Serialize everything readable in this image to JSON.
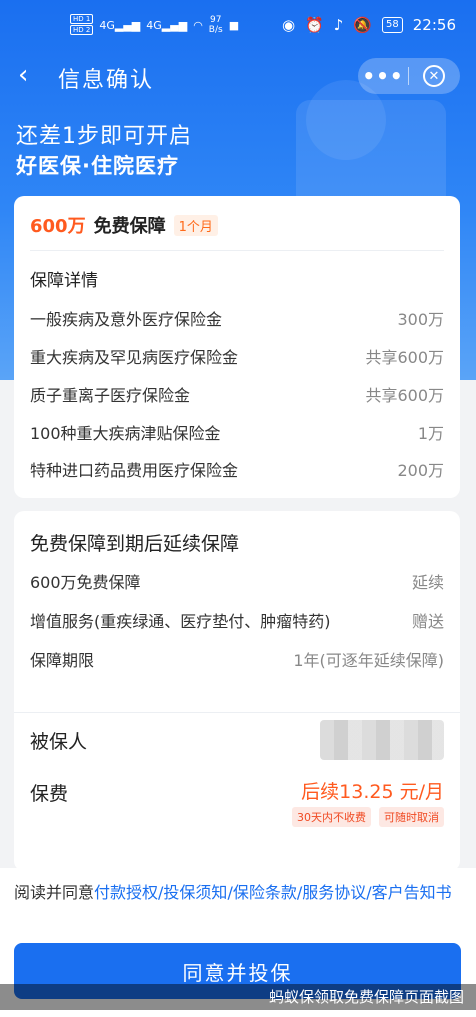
{
  "status_bar": {
    "hd1": "HD 1",
    "hd2": "HD 2",
    "net1": "4G",
    "net2": "4G",
    "speed_value": "97",
    "speed_unit": "B/s",
    "battery": "58",
    "time": "22:56"
  },
  "nav": {
    "back": "‹",
    "title": "信息确认",
    "more": "•••",
    "close": "✕"
  },
  "hero": {
    "line1": "还差1步即可开启",
    "line2": "好医保·住院医疗"
  },
  "coverage_card": {
    "amount": "600万",
    "free_label": "免费保障",
    "period_badge": "1个月",
    "section_title": "保障详情",
    "rows": [
      {
        "label": "一般疾病及意外医疗保险金",
        "value": "300万"
      },
      {
        "label": "重大疾病及罕见病医疗保险金",
        "value": "共享600万"
      },
      {
        "label": "质子重离子医疗保险金",
        "value": "共享600万"
      },
      {
        "label": "100种重大疾病津贴保险金",
        "value": "1万"
      },
      {
        "label": "特种进口药品费用医疗保险金",
        "value": "200万"
      }
    ]
  },
  "renewal_card": {
    "title": "免费保障到期后延续保障",
    "rows": [
      {
        "label": "600万免费保障",
        "value": "延续"
      },
      {
        "label": "增值服务(重疾绿通、医疗垫付、肿瘤特药)",
        "value": "赠送"
      },
      {
        "label": "保障期限",
        "value": "1年(可逐年延续保障)"
      }
    ],
    "insured_label": "被保人",
    "fee_label": "保费",
    "fee_value": "后续13.25 元/月",
    "tags": [
      "30天内不收费",
      "可随时取消"
    ]
  },
  "agreement": {
    "prefix": "阅读并同意",
    "links": [
      "付款授权",
      "投保须知",
      "保险条款",
      "服务协议",
      "客户告知书"
    ],
    "separator": "/"
  },
  "cta": {
    "label": "同意并投保"
  },
  "watermark": "蚂蚁保领取免费保障页面截图",
  "colors": {
    "primary": "#1a6ff0",
    "accent": "#ff5a1f",
    "tag_text": "#f04a23"
  }
}
